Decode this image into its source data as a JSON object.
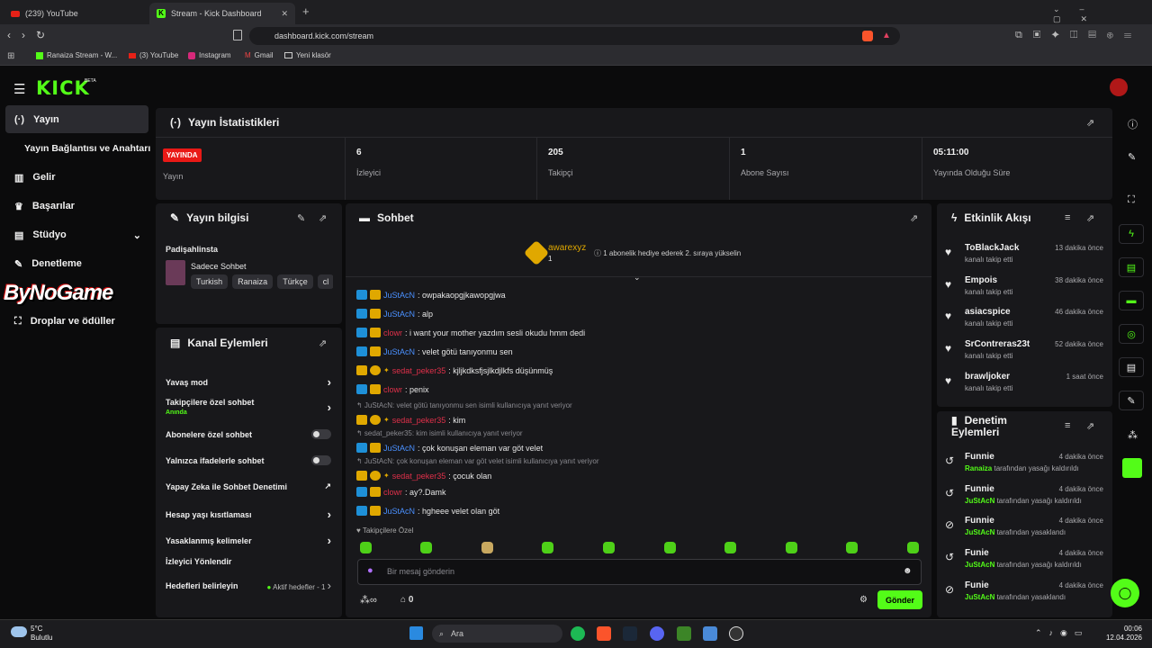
{
  "browser": {
    "tabs": [
      {
        "title": "(239) YouTube"
      },
      {
        "title": "Stream - Kick Dashboard"
      }
    ],
    "url": "dashboard.kick.com/stream",
    "bookmarks": [
      "Ranaiza Stream - W...",
      "(3) YouTube",
      "Instagram",
      "Gmail",
      "Yeni klasör"
    ]
  },
  "brand": {
    "logo": "KICK",
    "badge": "BETA"
  },
  "sidebar": {
    "items": [
      {
        "label": "Yayın",
        "icon": "broadcast-icon"
      },
      {
        "label": "Yayın Bağlantısı ve Anahtarı"
      },
      {
        "label": "Gelir",
        "icon": "chart-icon"
      },
      {
        "label": "Başarılar",
        "icon": "trophy-icon"
      },
      {
        "label": "Stüdyo",
        "icon": "studio-icon"
      },
      {
        "label": "Denetleme",
        "icon": "wrench-icon"
      },
      {
        "label": "Droplar ve ödüller",
        "icon": "gift-icon"
      }
    ],
    "overlay_logo": "ByNoGame"
  },
  "stats": {
    "title": "Yayın İstatistikleri",
    "live_badge": "YAYINDA",
    "live_label": "Yayın",
    "items": [
      {
        "value": "6",
        "label": "İzleyici"
      },
      {
        "value": "205",
        "label": "Takipçi"
      },
      {
        "value": "1",
        "label": "Abone Sayısı"
      },
      {
        "value": "05:11:00",
        "label": "Yayında Olduğu Süre"
      }
    ]
  },
  "stream_info": {
    "title": "Yayın bilgisi",
    "stream_title": "Padişahlinsta",
    "category": "Sadece Sohbet",
    "tags": [
      "Turkish",
      "Ranaiza",
      "Türkçe",
      "cl"
    ]
  },
  "channel_actions": {
    "title": "Kanal Eylemleri",
    "rows": [
      {
        "label": "Yavaş mod"
      },
      {
        "label": "Takipçilere özel sohbet",
        "sub": "Anında"
      },
      {
        "label": "Abonelere özel sohbet"
      },
      {
        "label": "Yalnızca ifadelerle sohbet"
      },
      {
        "label": "Yapay Zeka ile Sohbet Denetimi"
      },
      {
        "label": "Hesap yaşı kısıtlaması"
      },
      {
        "label": "Yasaklanmış kelimeler"
      },
      {
        "label": "İzleyici Yönlendir"
      },
      {
        "label": "Hedefleri belirleyin",
        "extra": "Aktif hedefler - 1"
      }
    ]
  },
  "chat": {
    "title": "Sohbet",
    "pinned": {
      "user": "awarexyz",
      "count": "1",
      "text": "1 abonelik hediye ederek 2. sıraya yükselin"
    },
    "messages": [
      {
        "user": "JuStAcN",
        "text": ": owpakaopgjkawopgjwa",
        "color": "#4a90ff"
      },
      {
        "user": "JuStAcN",
        "text": ": alp",
        "color": "#4a90ff"
      },
      {
        "user": "clowr",
        "text": ": i want your mother yazdım sesli okudu hmm dedi",
        "color": "#e0304a"
      },
      {
        "user": "JuStAcN",
        "text": ": velet götü tanıyonmu sen",
        "color": "#4a90ff"
      },
      {
        "user": "sedat_peker35",
        "text": ": kjljkdksfjsjlkdjlkfs düşünmüş",
        "color": "#e0304a"
      },
      {
        "user": "clowr",
        "text": ": penix",
        "color": "#e0304a"
      },
      {
        "reply": "JuStAcN: velet götü tanıyonmu sen isimli kullanıcıya yanıt veriyor",
        "user": "sedat_peker35",
        "text": ": kim",
        "color": "#e0304a"
      },
      {
        "reply": "sedat_peker35: kim isimli kullanıcıya yanıt veriyor",
        "user": "JuStAcN",
        "text": ": çok konuşan eleman var göt velet",
        "color": "#4a90ff"
      },
      {
        "reply": "JuStAcN: çok konuşan eleman var göt velet isimli kullanıcıya yanıt veriyor",
        "user": "sedat_peker35",
        "text": ": çocuk olan",
        "color": "#e0304a"
      },
      {
        "user": "clowr",
        "text": ": ay?.Damk",
        "color": "#e0304a"
      },
      {
        "user": "JuStAcN",
        "text": ": hgheee velet olan göt",
        "color": "#4a90ff"
      }
    ],
    "followers_label": "Takipçilere Özel",
    "input_placeholder": "Bir mesaj gönderin",
    "points": "0",
    "send_label": "Gönder"
  },
  "activity": {
    "title": "Etkinlik Akışı",
    "items": [
      {
        "name": "ToBlackJack",
        "time": "13 dakika önce",
        "desc": "kanalı takip etti"
      },
      {
        "name": "Empois",
        "time": "38 dakika önce",
        "desc": "kanalı takip etti"
      },
      {
        "name": "asiacspice",
        "time": "46 dakika önce",
        "desc": "kanalı takip etti"
      },
      {
        "name": "SrContreras23t",
        "time": "52 dakika önce",
        "desc": "kanalı takip etti"
      },
      {
        "name": "brawljoker",
        "time": "1 saat önce",
        "desc": "kanalı takip etti"
      }
    ]
  },
  "moderation": {
    "title": "Denetim Eylemleri",
    "items": [
      {
        "name": "Funnie",
        "time": "4 dakika önce",
        "by": "Ranaiza",
        "desc": "tarafından yasağı kaldırıldı"
      },
      {
        "name": "Funnie",
        "time": "4 dakika önce",
        "by": "JuStAcN",
        "desc": "tarafından yasağı kaldırıldı"
      },
      {
        "name": "Funnie",
        "time": "4 dakika önce",
        "by": "JuStAcN",
        "desc": "tarafından yasaklandı"
      },
      {
        "name": "Funie",
        "time": "4 dakika önce",
        "by": "JuStAcN",
        "desc": "tarafından yasağı kaldırıldı"
      },
      {
        "name": "Funie",
        "time": "4 dakika önce",
        "by": "JuStAcN",
        "desc": "tarafından yasaklandı"
      }
    ]
  },
  "taskbar": {
    "weather_temp": "5°C",
    "weather_desc": "Bulutlu",
    "search": "Ara",
    "time": "00:06",
    "date": "12.04.2026"
  },
  "colors": {
    "accent": "#53fc18",
    "live": "#e91916",
    "panel": "#18181b"
  }
}
